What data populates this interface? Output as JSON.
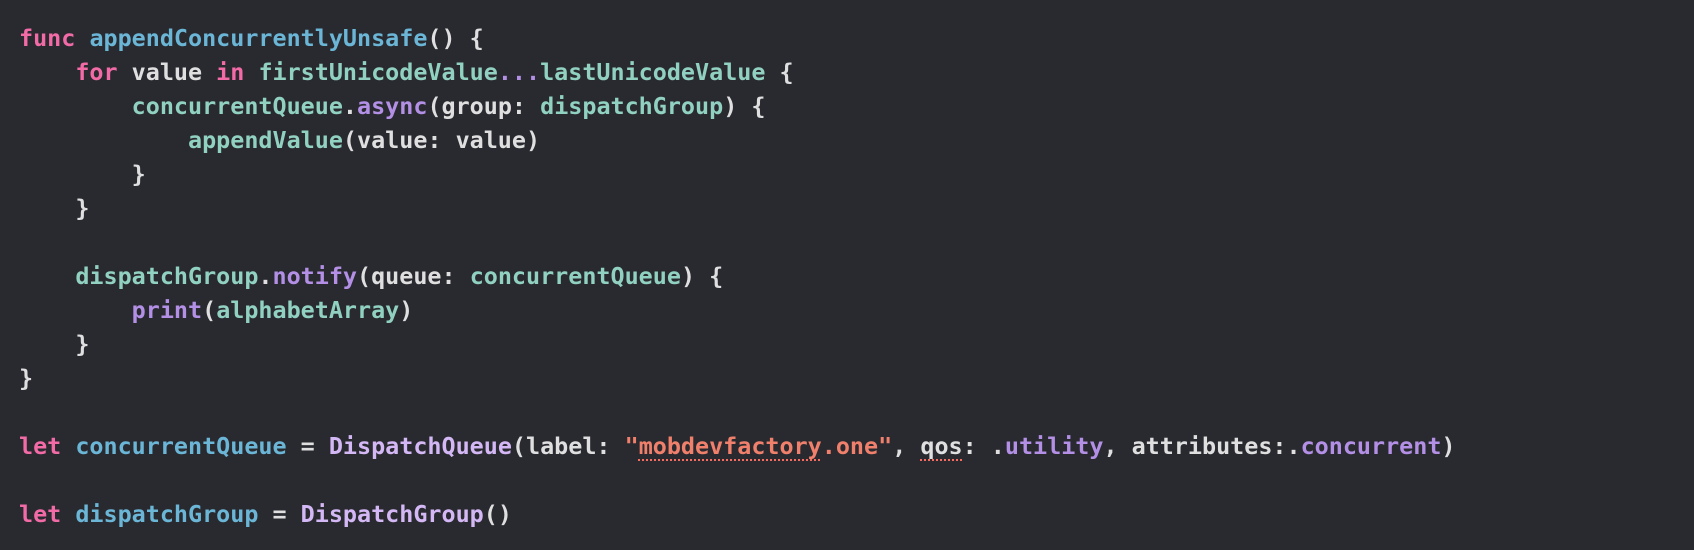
{
  "editor": {
    "background": "#292a30",
    "colors": {
      "keyword": "#f26aa6",
      "declaration": "#6bb6d6",
      "project_symbol": "#91d1c2",
      "system_symbol": "#b390e6",
      "string": "#f0806b",
      "plain": "#dfdfe0"
    },
    "lines": [
      [
        "func",
        " ",
        "appendConcurrentlyUnsafe",
        "() {"
      ],
      [
        "    ",
        "for",
        " value ",
        "in",
        " ",
        "firstUnicodeValue",
        "...",
        "lastUnicodeValue",
        " {"
      ],
      [
        "        ",
        "concurrentQueue",
        ".",
        "async",
        "(group: ",
        "dispatchGroup",
        ") {"
      ],
      [
        "            ",
        "appendValue",
        "(value: value)"
      ],
      [
        "        }"
      ],
      [
        "    }"
      ],
      [
        ""
      ],
      [
        "    ",
        "dispatchGroup",
        ".",
        "notify",
        "(queue: ",
        "concurrentQueue",
        ") {"
      ],
      [
        "        ",
        "print",
        "(",
        "alphabetArray",
        ")"
      ],
      [
        "    }"
      ],
      [
        "}"
      ],
      [
        ""
      ],
      [
        "let",
        " ",
        "concurrentQueue",
        " = ",
        "DispatchQueue",
        "(label: ",
        "\"",
        "mobdevfactory",
        ".one\"",
        ", ",
        "qos",
        ": .",
        "utility",
        ", attributes:.",
        "concurrent",
        ")"
      ],
      [
        ""
      ],
      [
        "let",
        " ",
        "dispatchGroup",
        " = ",
        "DispatchGroup",
        "()"
      ]
    ]
  }
}
